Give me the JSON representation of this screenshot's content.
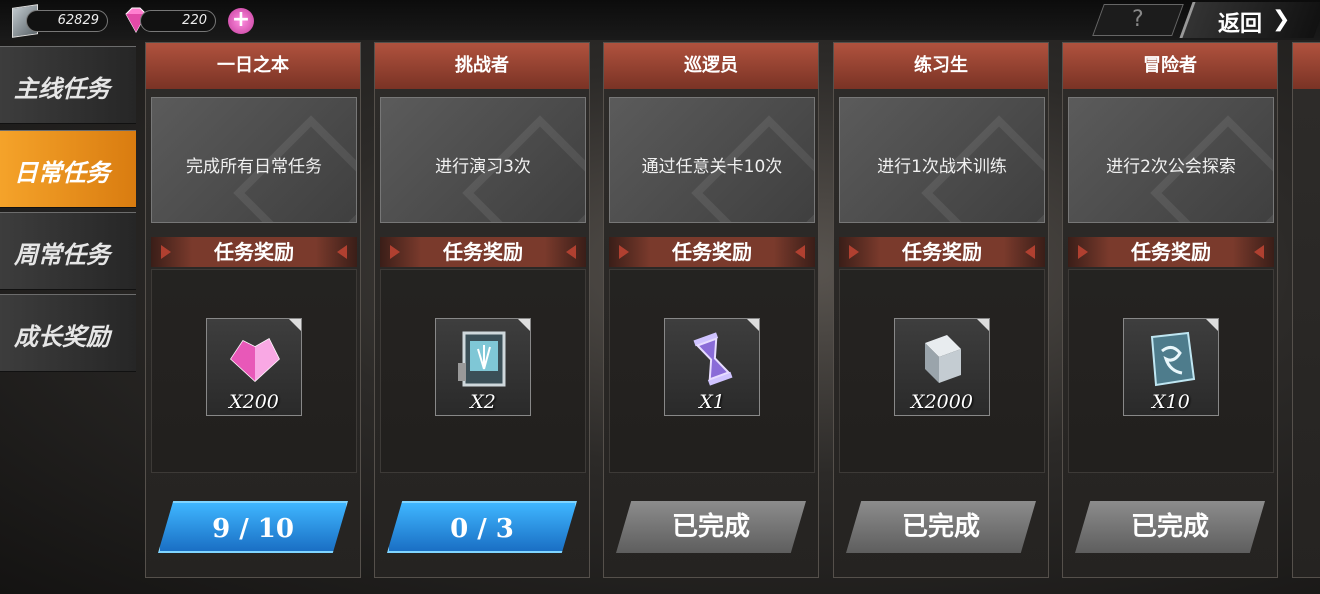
{
  "resources": [
    {
      "icon": "silver-coin-icon",
      "value": "62829"
    },
    {
      "icon": "pink-gem-icon",
      "value": "220"
    }
  ],
  "top": {
    "help_label": "?",
    "back_label": "返回",
    "back_arrow": "❯"
  },
  "tabs": [
    {
      "label": "主线任务",
      "active": false
    },
    {
      "label": "日常任务",
      "active": true
    },
    {
      "label": "周常任务",
      "active": false
    },
    {
      "label": "成长奖励",
      "active": false
    }
  ],
  "reward_header": "任务奖励",
  "cards": [
    {
      "title": "一日之本",
      "description": "完成所有日常任务",
      "item_icon": "pink-gem-icon",
      "quantity": "X200",
      "status": "9 / 10",
      "completed": false
    },
    {
      "title": "挑战者",
      "description": "进行演习3次",
      "item_icon": "training-ticket-icon",
      "quantity": "X2",
      "status": "0 / 3",
      "completed": false
    },
    {
      "title": "巡逻员",
      "description": "通过任意关卡10次",
      "item_icon": "hourglass-icon",
      "quantity": "X1",
      "status": "已完成",
      "completed": true
    },
    {
      "title": "练习生",
      "description": "进行1次战术训练",
      "item_icon": "notebook-icon",
      "quantity": "X2000",
      "status": "已完成",
      "completed": true
    },
    {
      "title": "冒险者",
      "description": "进行2次公会探索",
      "item_icon": "map-crystal-icon",
      "quantity": "X10",
      "status": "已完成",
      "completed": true
    }
  ],
  "colors": {
    "active_tab": "#f5a32a",
    "progress_button": "#3fb6ff",
    "done_button": "#8c8c8c",
    "card_header": "#b0523e"
  }
}
